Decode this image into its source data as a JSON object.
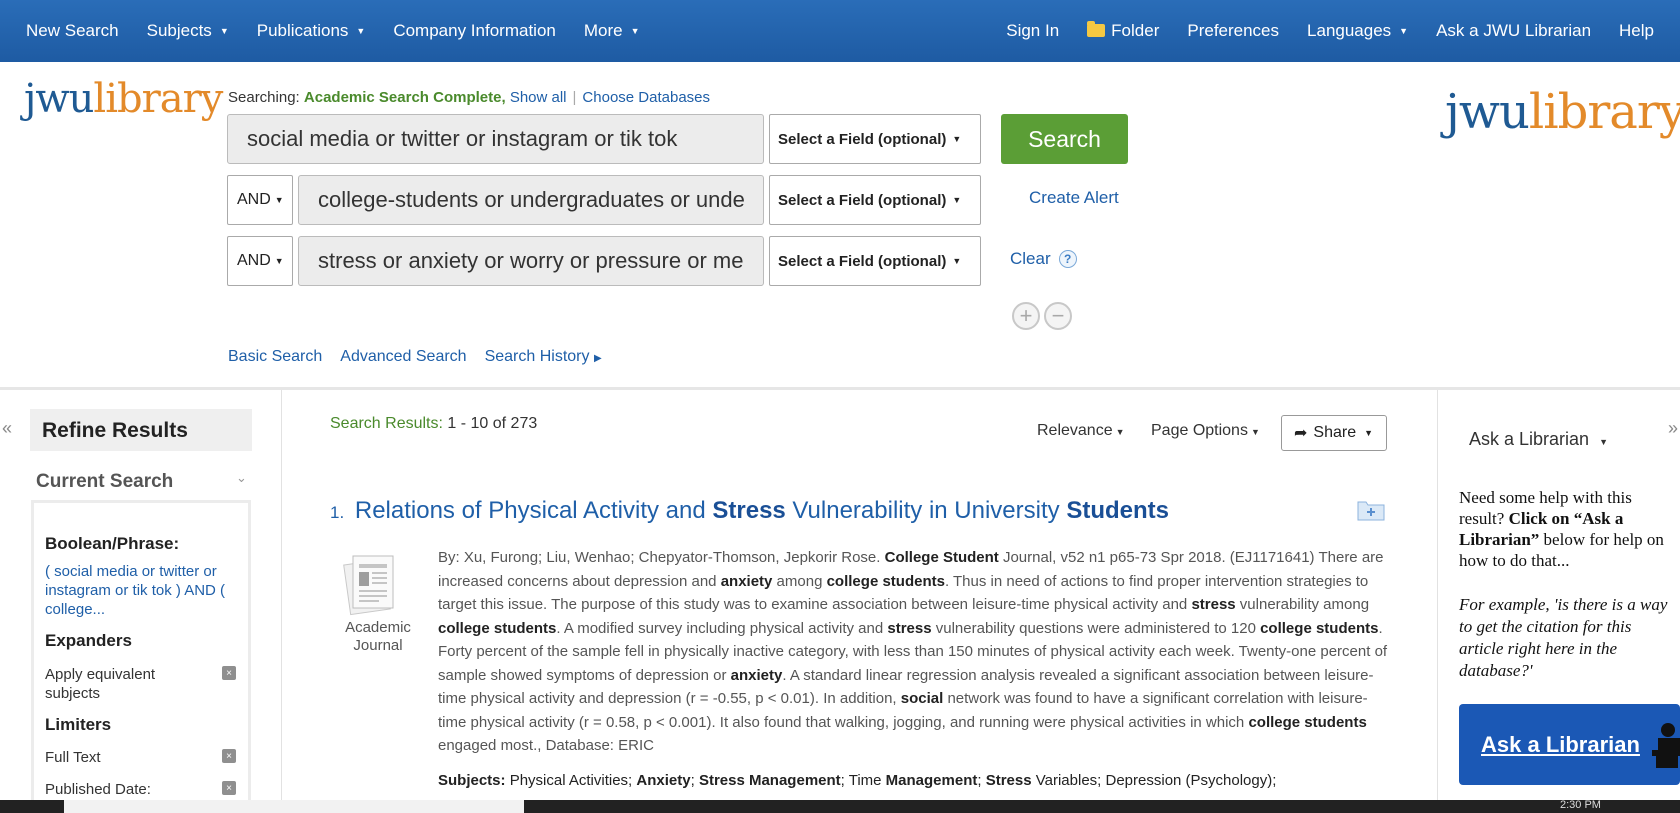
{
  "nav": {
    "left": [
      {
        "label": "New Search",
        "caret": false
      },
      {
        "label": "Subjects",
        "caret": true
      },
      {
        "label": "Publications",
        "caret": true
      },
      {
        "label": "Company Information",
        "caret": false
      },
      {
        "label": "More",
        "caret": true
      }
    ],
    "signin": "Sign In",
    "folder": "Folder",
    "preferences": "Preferences",
    "languages": "Languages",
    "ask": "Ask a JWU Librarian",
    "help": "Help"
  },
  "logo": {
    "jwu": "jwu",
    "library": "library"
  },
  "search": {
    "searching_label": "Searching:",
    "database": "Academic Search Complete,",
    "show_all": "Show all",
    "choose_databases": "Choose Databases",
    "rows": [
      {
        "operator": "",
        "query": "social media or twitter or instagram or tik tok",
        "field": "Select a Field (optional)"
      },
      {
        "operator": "AND",
        "query": "college-students or undergraduates or unde",
        "field": "Select a Field (optional)"
      },
      {
        "operator": "AND",
        "query": "stress or anxiety or worry or pressure or me",
        "field": "Select a Field (optional)"
      }
    ],
    "search_button": "Search",
    "create_alert": "Create Alert",
    "clear": "Clear",
    "help": "?",
    "plus": "+",
    "minus": "−",
    "links": [
      "Basic Search",
      "Advanced Search",
      "Search History"
    ]
  },
  "sidebar": {
    "collapse": "«",
    "refine_title": "Refine Results",
    "current_search": "Current Search",
    "boolean_heading": "Boolean/Phrase:",
    "boolean_text": "( social media or twitter or instagram or tik tok ) AND ( college...",
    "expanders_heading": "Expanders",
    "expander_item": "Apply equivalent subjects",
    "limiters_heading": "Limiters",
    "limiter_items": [
      "Full Text",
      "Published Date:"
    ],
    "remove": "×"
  },
  "results": {
    "label": "Search Results:",
    "range": "1 - 10 of 273",
    "sort": "Relevance",
    "page_options": "Page Options",
    "share": "Share",
    "items": [
      {
        "number": "1.",
        "title_parts": [
          "Relations of Physical Activity and ",
          "Stress",
          " Vulnerability in University ",
          "Students"
        ],
        "pub_type": "Academic Journal",
        "byline": "By: Xu, Furong; Liu, Wenhao; Chepyator-Thomson, Jepkorir Rose.",
        "journal_bold": "College Student",
        "journal_rest": " Journal, v52 n1 p65-73 Spr 2018. (EJ1171641)",
        "abstract": [
          "There are increased concerns about depression and ",
          "anxiety",
          " among ",
          "college students",
          ". Thus in need of actions to find proper intervention strategies to target this issue. The purpose of this study was to examine association between leisure-time physical activity and ",
          "stress",
          " vulnerability among ",
          "college students",
          ". A modified survey including physical activity and ",
          "stress",
          " vulnerability questions were administered to 120 ",
          "college students",
          ". Forty percent of the sample fell in physically inactive category, with less than 150 minutes of physical activity each week. Twenty-one percent of sample showed symptoms of depression or ",
          "anxiety",
          ". A standard linear regression analysis revealed a significant association between leisure-time physical activity and depression (r = -0.55, p < 0.01). In addition, ",
          "social",
          " network was found to have a significant correlation with leisure-time physical activity (r = 0.58, p < 0.001). It also found that walking, jogging, and running were physical activities in which ",
          "college students",
          " engaged most., Database: ERIC"
        ],
        "subjects_label": "Subjects:",
        "subjects": [
          "Physical Activities; ",
          "Anxiety",
          "; ",
          "Stress Management",
          "; Time ",
          "Management",
          "; ",
          "Stress",
          " Variables; Depression (Psychology);"
        ]
      }
    ]
  },
  "right_panel": {
    "collapse": "»",
    "ask_dropdown": "Ask a Librarian",
    "help_intro": "Need some help with this result? ",
    "help_bold": "Click on “Ask a Librarian”",
    "help_rest": " below for help on how to do that...",
    "example": "For example, 'is there is a way to get the citation for this article right here in the database?'",
    "ask_button": "Ask a Librarian"
  },
  "taskbar": {
    "clock": "2:30 PM"
  },
  "colors": {
    "nav": "#1e5ba3",
    "search_button": "#5b9e36",
    "link": "#1f5fa8",
    "logo_blue": "#1f5a93",
    "logo_orange": "#e38a2a"
  }
}
